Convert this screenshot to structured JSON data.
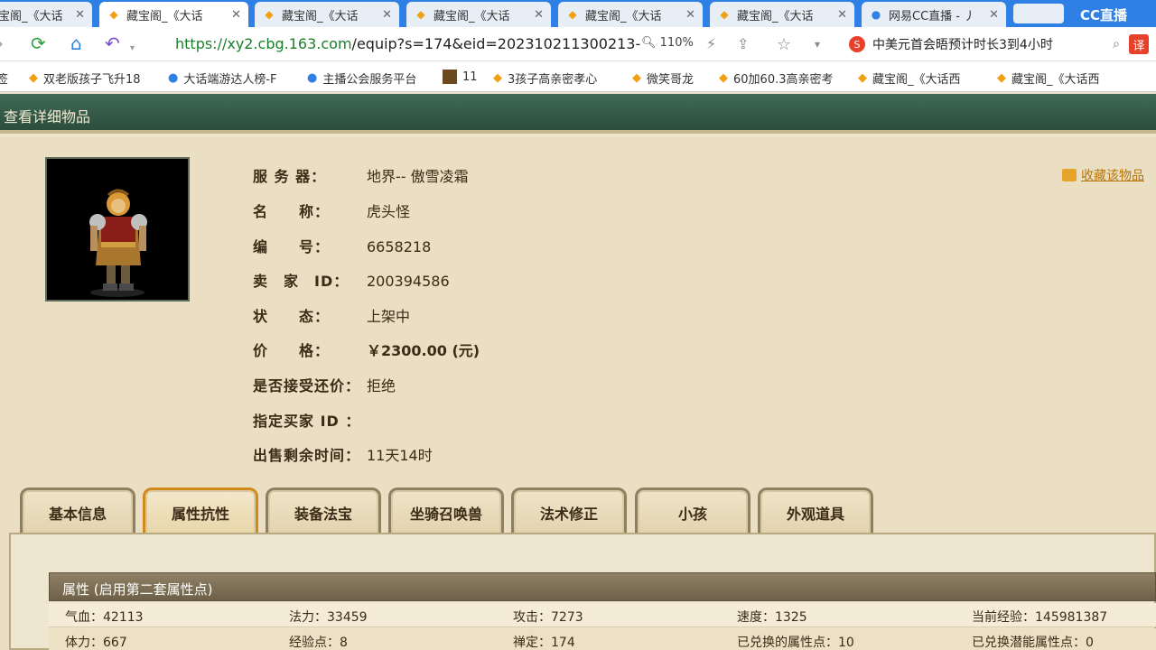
{
  "browser": {
    "tabs": [
      {
        "title": "宝阁_《大话"
      },
      {
        "title": "藏宝阁_《大话"
      },
      {
        "title": "藏宝阁_《大话"
      },
      {
        "title": "藏宝阁_《大话"
      },
      {
        "title": "藏宝阁_《大话"
      },
      {
        "title": "藏宝阁_《大话"
      },
      {
        "title": "网易CC直播 - 丿"
      }
    ],
    "overlay_logo": "CC直播",
    "url_host": "https://xy2.cbg.163.com",
    "url_path": "/equip?s=174&eid=202310211300213-",
    "zoom": "110%",
    "search_text": "中美元首会晤预计时长3到4小时",
    "translate_label": "译",
    "bookmarks": [
      {
        "label": "签"
      },
      {
        "label": "双老版孩子飞升18"
      },
      {
        "label": "大话端游达人榜-F"
      },
      {
        "label": "主播公会服务平台"
      },
      {
        "label": "11"
      },
      {
        "label": "3孩子高亲密孝心"
      },
      {
        "label": "微笑哥龙"
      },
      {
        "label": "60加60.3高亲密考"
      },
      {
        "label": "藏宝阁_《大话西"
      },
      {
        "label": "藏宝阁_《大话西"
      }
    ]
  },
  "page": {
    "header_title": "查看详细物品",
    "favorite_label": "收藏该物品",
    "info": [
      {
        "label": "服 务 器：",
        "value": "地界-- 傲雪凌霜"
      },
      {
        "label": "名　　称：",
        "value": "虎头怪"
      },
      {
        "label": "编　　号：",
        "value": "6658218"
      },
      {
        "label": "卖　家　ID：",
        "value": "200394586"
      },
      {
        "label": "状　　态：",
        "value": "上架中"
      },
      {
        "label": "价　　格：",
        "value": "￥2300.00 (元)"
      },
      {
        "label": "是否接受还价：",
        "value": "拒绝"
      },
      {
        "label": "指定买家 ID ：",
        "value": ""
      },
      {
        "label": "出售剩余时间：",
        "value": "11天14时"
      }
    ],
    "tabs": [
      {
        "label": "基本信息"
      },
      {
        "label": "属性抗性"
      },
      {
        "label": "装备法宝"
      },
      {
        "label": "坐骑召唤兽"
      },
      {
        "label": "法术修正"
      },
      {
        "label": "小孩"
      },
      {
        "label": "外观道具"
      }
    ],
    "active_tab": "属性抗性",
    "attr_header": "属性 (启用第二套属性点)",
    "attr_rows": [
      [
        "气血：42113",
        "法力：33459",
        "攻击：7273",
        "速度：1325",
        "当前经验：145981387"
      ],
      [
        "体力：667",
        "经验点：8",
        "禅定：174",
        "已兑换的属性点：10",
        "已兑换潜能属性点：0"
      ]
    ]
  },
  "colors": {
    "tabbar_blue": "#2f80e4",
    "header_green": "#2c4d3c",
    "price_red": "#c00000",
    "active_tab_border": "#d08a1c"
  }
}
